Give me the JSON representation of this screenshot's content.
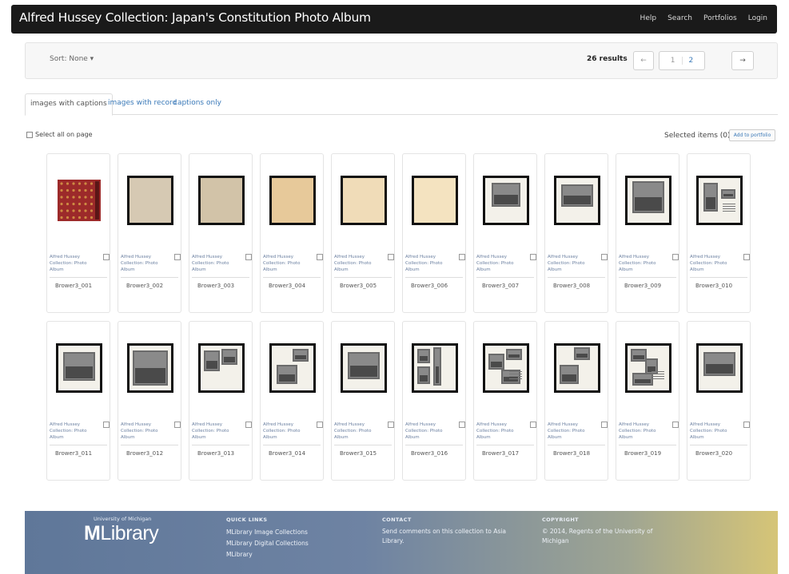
{
  "header": {
    "title": "Alfred Hussey Collection: Japan's Constitution Photo Album",
    "nav": [
      "Help",
      "Search",
      "Portfolios",
      "Login"
    ]
  },
  "toolbar": {
    "sort_label": "Sort: None ▾",
    "results": "26 results",
    "prev": "←",
    "pages": [
      "1",
      "2"
    ],
    "next": "→"
  },
  "tabs": [
    "images with captions",
    "images with record",
    "captions only"
  ],
  "selection": {
    "select_all": "Select all on page",
    "selected": "Selected items (0):",
    "add_button": "Add to portfolio"
  },
  "items": [
    {
      "caption": "Alfred Hussey Collection: Photo Album",
      "id": "Brower3_001"
    },
    {
      "caption": "Alfred Hussey Collection: Photo Album",
      "id": "Brower3_002"
    },
    {
      "caption": "Alfred Hussey Collection: Photo Album",
      "id": "Brower3_003"
    },
    {
      "caption": "Alfred Hussey Collection: Photo Album",
      "id": "Brower3_004"
    },
    {
      "caption": "Alfred Hussey Collection: Photo Album",
      "id": "Brower3_005"
    },
    {
      "caption": "Alfred Hussey Collection: Photo Album",
      "id": "Brower3_006"
    },
    {
      "caption": "Alfred Hussey Collection: Photo Album",
      "id": "Brower3_007"
    },
    {
      "caption": "Alfred Hussey Collection: Photo Album",
      "id": "Brower3_008"
    },
    {
      "caption": "Alfred Hussey Collection: Photo Album",
      "id": "Brower3_009"
    },
    {
      "caption": "Alfred Hussey Collection: Photo Album",
      "id": "Brower3_010"
    },
    {
      "caption": "Alfred Hussey Collection: Photo Album",
      "id": "Brower3_011"
    },
    {
      "caption": "Alfred Hussey Collection: Photo Album",
      "id": "Brower3_012"
    },
    {
      "caption": "Alfred Hussey Collection: Photo Album",
      "id": "Brower3_013"
    },
    {
      "caption": "Alfred Hussey Collection: Photo Album",
      "id": "Brower3_014"
    },
    {
      "caption": "Alfred Hussey Collection: Photo Album",
      "id": "Brower3_015"
    },
    {
      "caption": "Alfred Hussey Collection: Photo Album",
      "id": "Brower3_016"
    },
    {
      "caption": "Alfred Hussey Collection: Photo Album",
      "id": "Brower3_017"
    },
    {
      "caption": "Alfred Hussey Collection: Photo Album",
      "id": "Brower3_018"
    },
    {
      "caption": "Alfred Hussey Collection: Photo Album",
      "id": "Brower3_019"
    },
    {
      "caption": "Alfred Hussey Collection: Photo Album",
      "id": "Brower3_020"
    }
  ],
  "footer": {
    "logo_small": "University of Michigan",
    "logo_big_m": "M",
    "logo_big_rest": "Library",
    "quick_links_heading": "QUICK LINKS",
    "quick_links": [
      "MLibrary Image Collections",
      "MLibrary Digital Collections",
      "MLibrary"
    ],
    "contact_heading": "CONTACT",
    "contact_text": [
      "Send comments on this collection to Asia",
      "Library."
    ],
    "copyright_heading": "COPYRIGHT",
    "copyright_text": [
      "© 2014, Regents of the University of",
      "Michigan"
    ]
  }
}
